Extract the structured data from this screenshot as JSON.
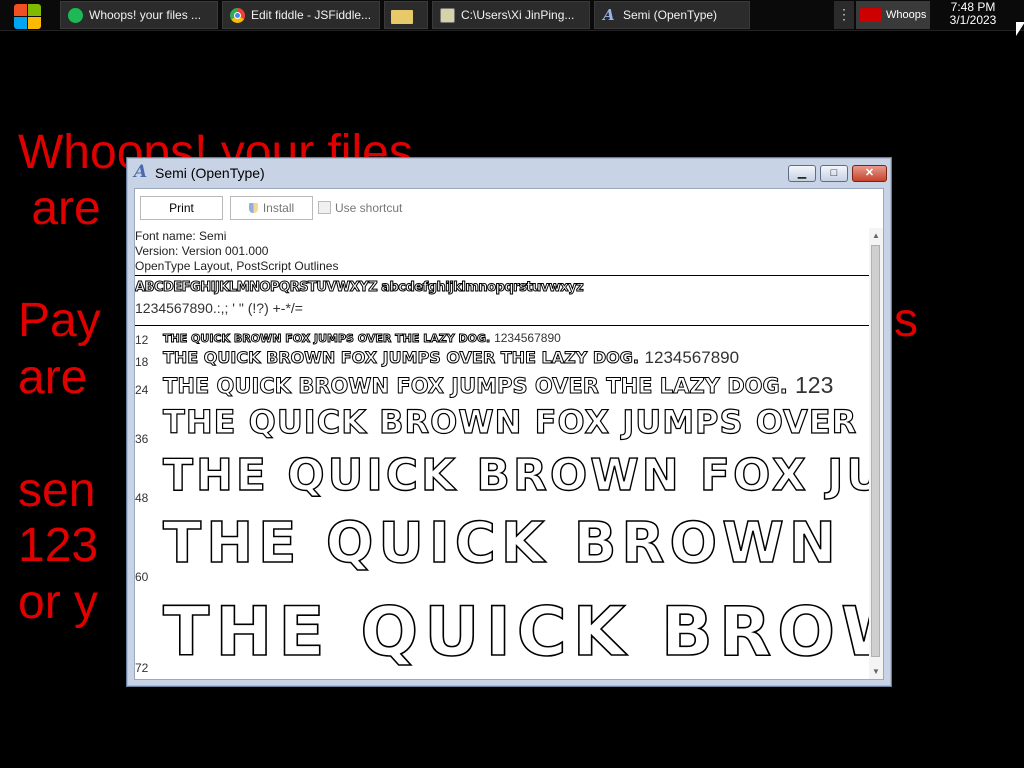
{
  "taskbar": {
    "tasks": [
      {
        "label": "Whoops! your files ..."
      },
      {
        "label": "Edit fiddle - JSFiddle..."
      },
      {
        "label": ""
      },
      {
        "label": "C:\\Users\\Xi JinPing..."
      },
      {
        "label": "Semi (OpenType)"
      }
    ],
    "tray_app": "Whoops",
    "clock": {
      "time": "7:48 PM",
      "date": "3/1/2023"
    }
  },
  "desktop": {
    "lines": [
      "Whoops! your files",
      " are",
      "Pay",
      "s",
      "are",
      "sen",
      "123",
      "or y"
    ]
  },
  "window": {
    "title": "Semi (OpenType)",
    "toolbar": {
      "print": "Print",
      "install": "Install",
      "shortcut": "Use shortcut"
    },
    "meta": {
      "font_name": "Font name: Semi",
      "version": "Version: Version 001.000",
      "layout": "OpenType Layout, PostScript Outlines"
    },
    "charset": {
      "letters": "ABCDEFGHIJKLMNOPQRSTUVWXYZ abcdefghijklmnopqrstuvwxyz",
      "symbols": "1234567890.:,; ' \" (!?) +-*/="
    },
    "samples": [
      {
        "size": "12",
        "text": "THE QUICK BROWN FOX JUMPS OVER THE LAZY DOG.",
        "num": "1234567890"
      },
      {
        "size": "18",
        "text": "THE QUICK BROWN FOX JUMPS OVER THE LAZY DOG.",
        "num": "1234567890"
      },
      {
        "size": "24",
        "text": "THE QUICK BROWN FOX JUMPS OVER THE LAZY DOG.",
        "num": "123"
      },
      {
        "size": "36",
        "text": "THE QUICK BROWN FOX JUMPS OVER",
        "num": ""
      },
      {
        "size": "48",
        "text": "THE QUICK BROWN FOX JUM",
        "num": ""
      },
      {
        "size": "60",
        "text": "THE QUICK BROWN FO",
        "num": ""
      },
      {
        "size": "72",
        "text": "THE QUICK BROWN",
        "num": ""
      }
    ]
  }
}
